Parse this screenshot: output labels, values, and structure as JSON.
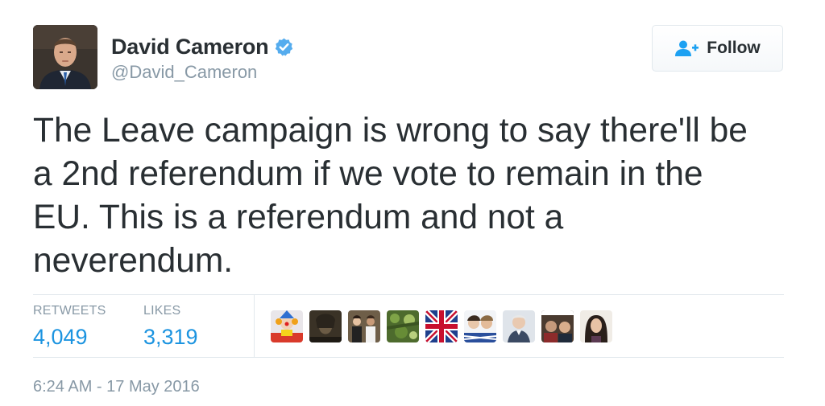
{
  "user": {
    "display_name": "David Cameron",
    "handle": "@David_Cameron",
    "verified_icon": "verified-badge-icon",
    "verified_color": "#55acee"
  },
  "follow_button": {
    "label": "Follow",
    "icon": "follow-user-icon",
    "icon_color": "#1da1f2"
  },
  "tweet": {
    "text": "The Leave campaign is wrong to say there'll be\na 2nd referendum if we vote to remain in the\nEU. This is a referendum and not a\nneverendum."
  },
  "stats": {
    "retweets_label": "RETWEETS",
    "retweets_value": "4,049",
    "likes_label": "LIKES",
    "likes_value": "3,319",
    "value_color": "#1c94e0"
  },
  "likers": [
    {
      "icon": "liker-avatar-clown"
    },
    {
      "icon": "liker-avatar-portrait-painting"
    },
    {
      "icon": "liker-avatar-group-photo"
    },
    {
      "icon": "liker-avatar-green-pattern"
    },
    {
      "icon": "liker-avatar-union-flag"
    },
    {
      "icon": "liker-avatar-faces"
    },
    {
      "icon": "liker-avatar-elderly-man"
    },
    {
      "icon": "liker-avatar-two-faces"
    },
    {
      "icon": "liker-avatar-woman"
    }
  ],
  "timestamp": "6:24 AM - 17 May 2016"
}
